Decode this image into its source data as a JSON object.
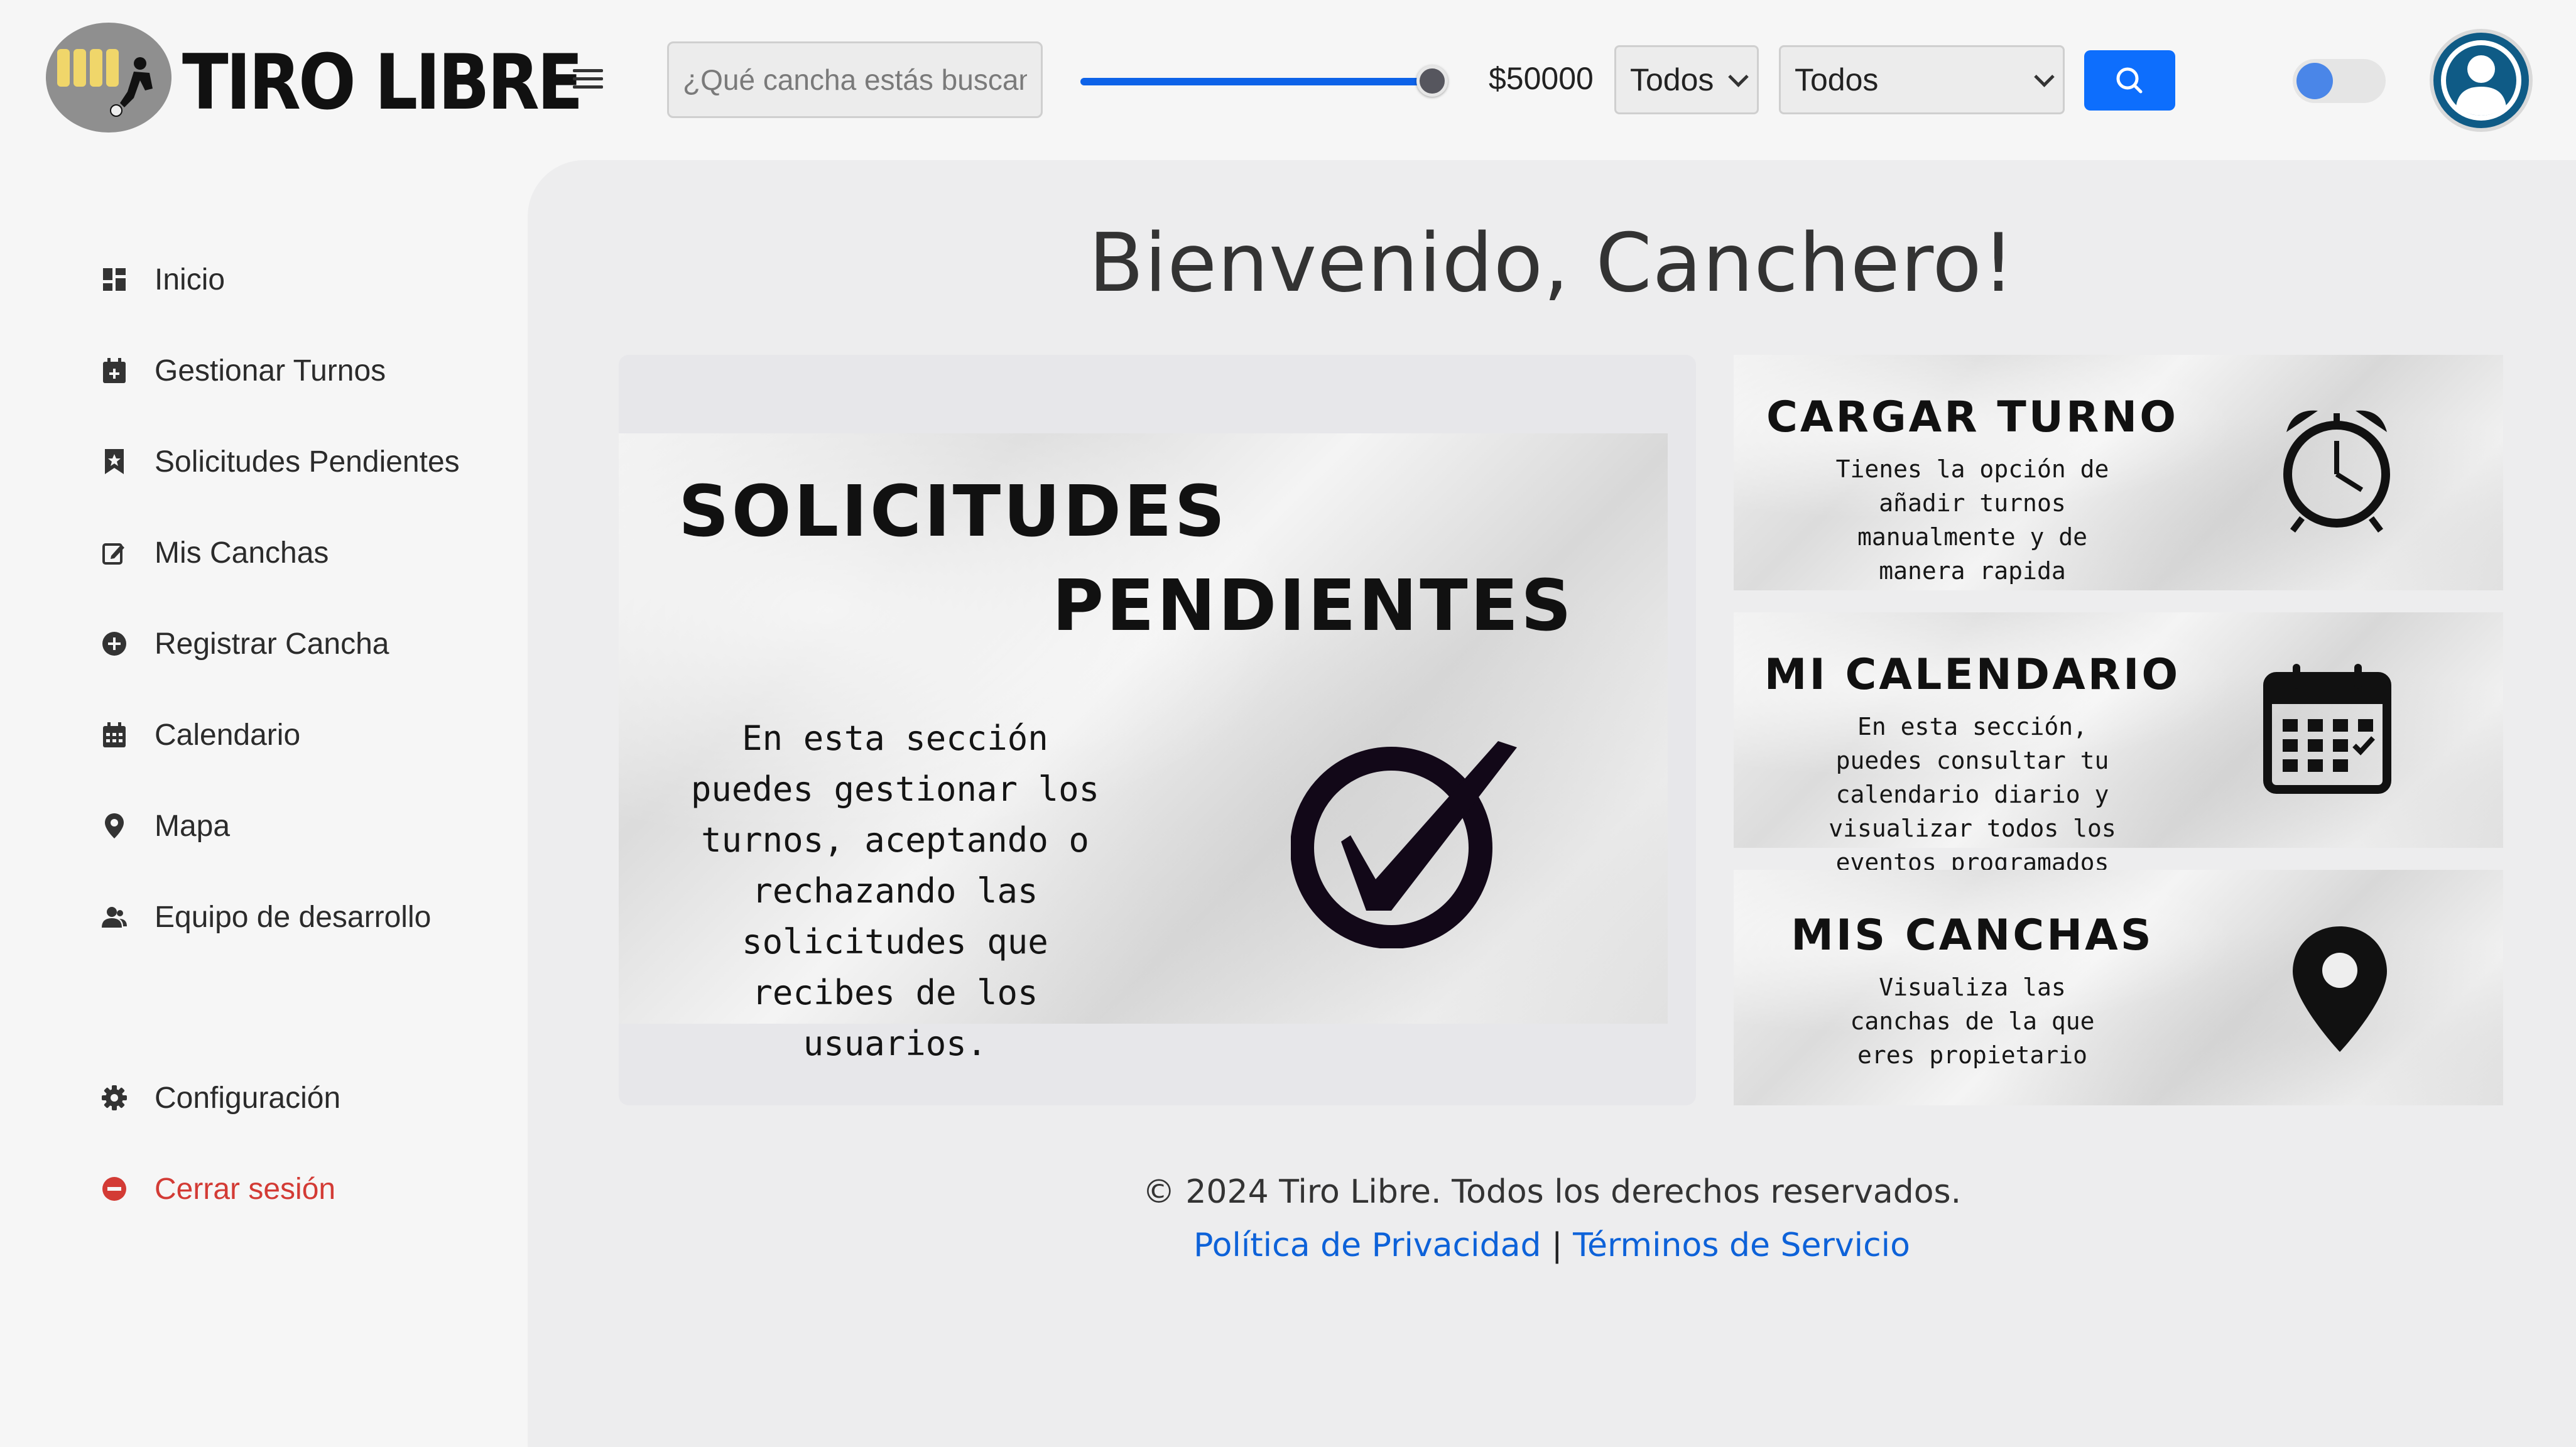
{
  "header": {
    "logo_text": "TIRO LIBRE",
    "search_placeholder": "¿Qué cancha estás buscando?",
    "price_slider": {
      "value": 50000,
      "fraction": 1.0
    },
    "price_label": "$50000",
    "filter_1": {
      "selected": "Todos"
    },
    "filter_2": {
      "selected": "Todos"
    },
    "toggle": {
      "state": "off"
    },
    "accent_color": "#0d6efd"
  },
  "sidebar": {
    "items": [
      {
        "label": "Inicio",
        "icon": "dashboard-icon"
      },
      {
        "label": "Gestionar Turnos",
        "icon": "calendar-plus-icon"
      },
      {
        "label": "Solicitudes Pendientes",
        "icon": "bookmark-icon"
      },
      {
        "label": "Mis Canchas",
        "icon": "edit-icon"
      },
      {
        "label": "Registrar Cancha",
        "icon": "plus-circle-icon"
      },
      {
        "label": "Calendario",
        "icon": "calendar-icon"
      },
      {
        "label": "Mapa",
        "icon": "map-pin-icon"
      },
      {
        "label": "Equipo de desarrollo",
        "icon": "team-icon"
      }
    ],
    "settings_label": "Configuración",
    "logout_label": "Cerrar sesión",
    "logout_color": "#d33b35"
  },
  "main": {
    "welcome": "Bienvenido, Canchero!",
    "big_card": {
      "title_line1": "SOLICITUDES",
      "title_line2": "PENDIENTES",
      "description": "En esta sección puedes gestionar los turnos, aceptando o rechazando las solicitudes que recibes de los usuarios."
    },
    "cards": [
      {
        "title": "CARGAR TURNO",
        "description": "Tienes la opción de añadir turnos manualmente y de manera rapida",
        "icon": "alarm-clock-icon"
      },
      {
        "title": "MI CALENDARIO",
        "description": "En esta sección, puedes consultar tu calendario diario y visualizar todos los eventos programados",
        "icon": "calendar-icon"
      },
      {
        "title": "MIS CANCHAS",
        "description": "Visualiza las canchas de la que eres propietario",
        "icon": "map-pin-icon"
      }
    ]
  },
  "footer": {
    "copyright": "© 2024 Tiro Libre. Todos los derechos reservados.",
    "privacy_link": "Política de Privacidad",
    "separator": "|",
    "terms_link": "Términos de Servicio"
  }
}
